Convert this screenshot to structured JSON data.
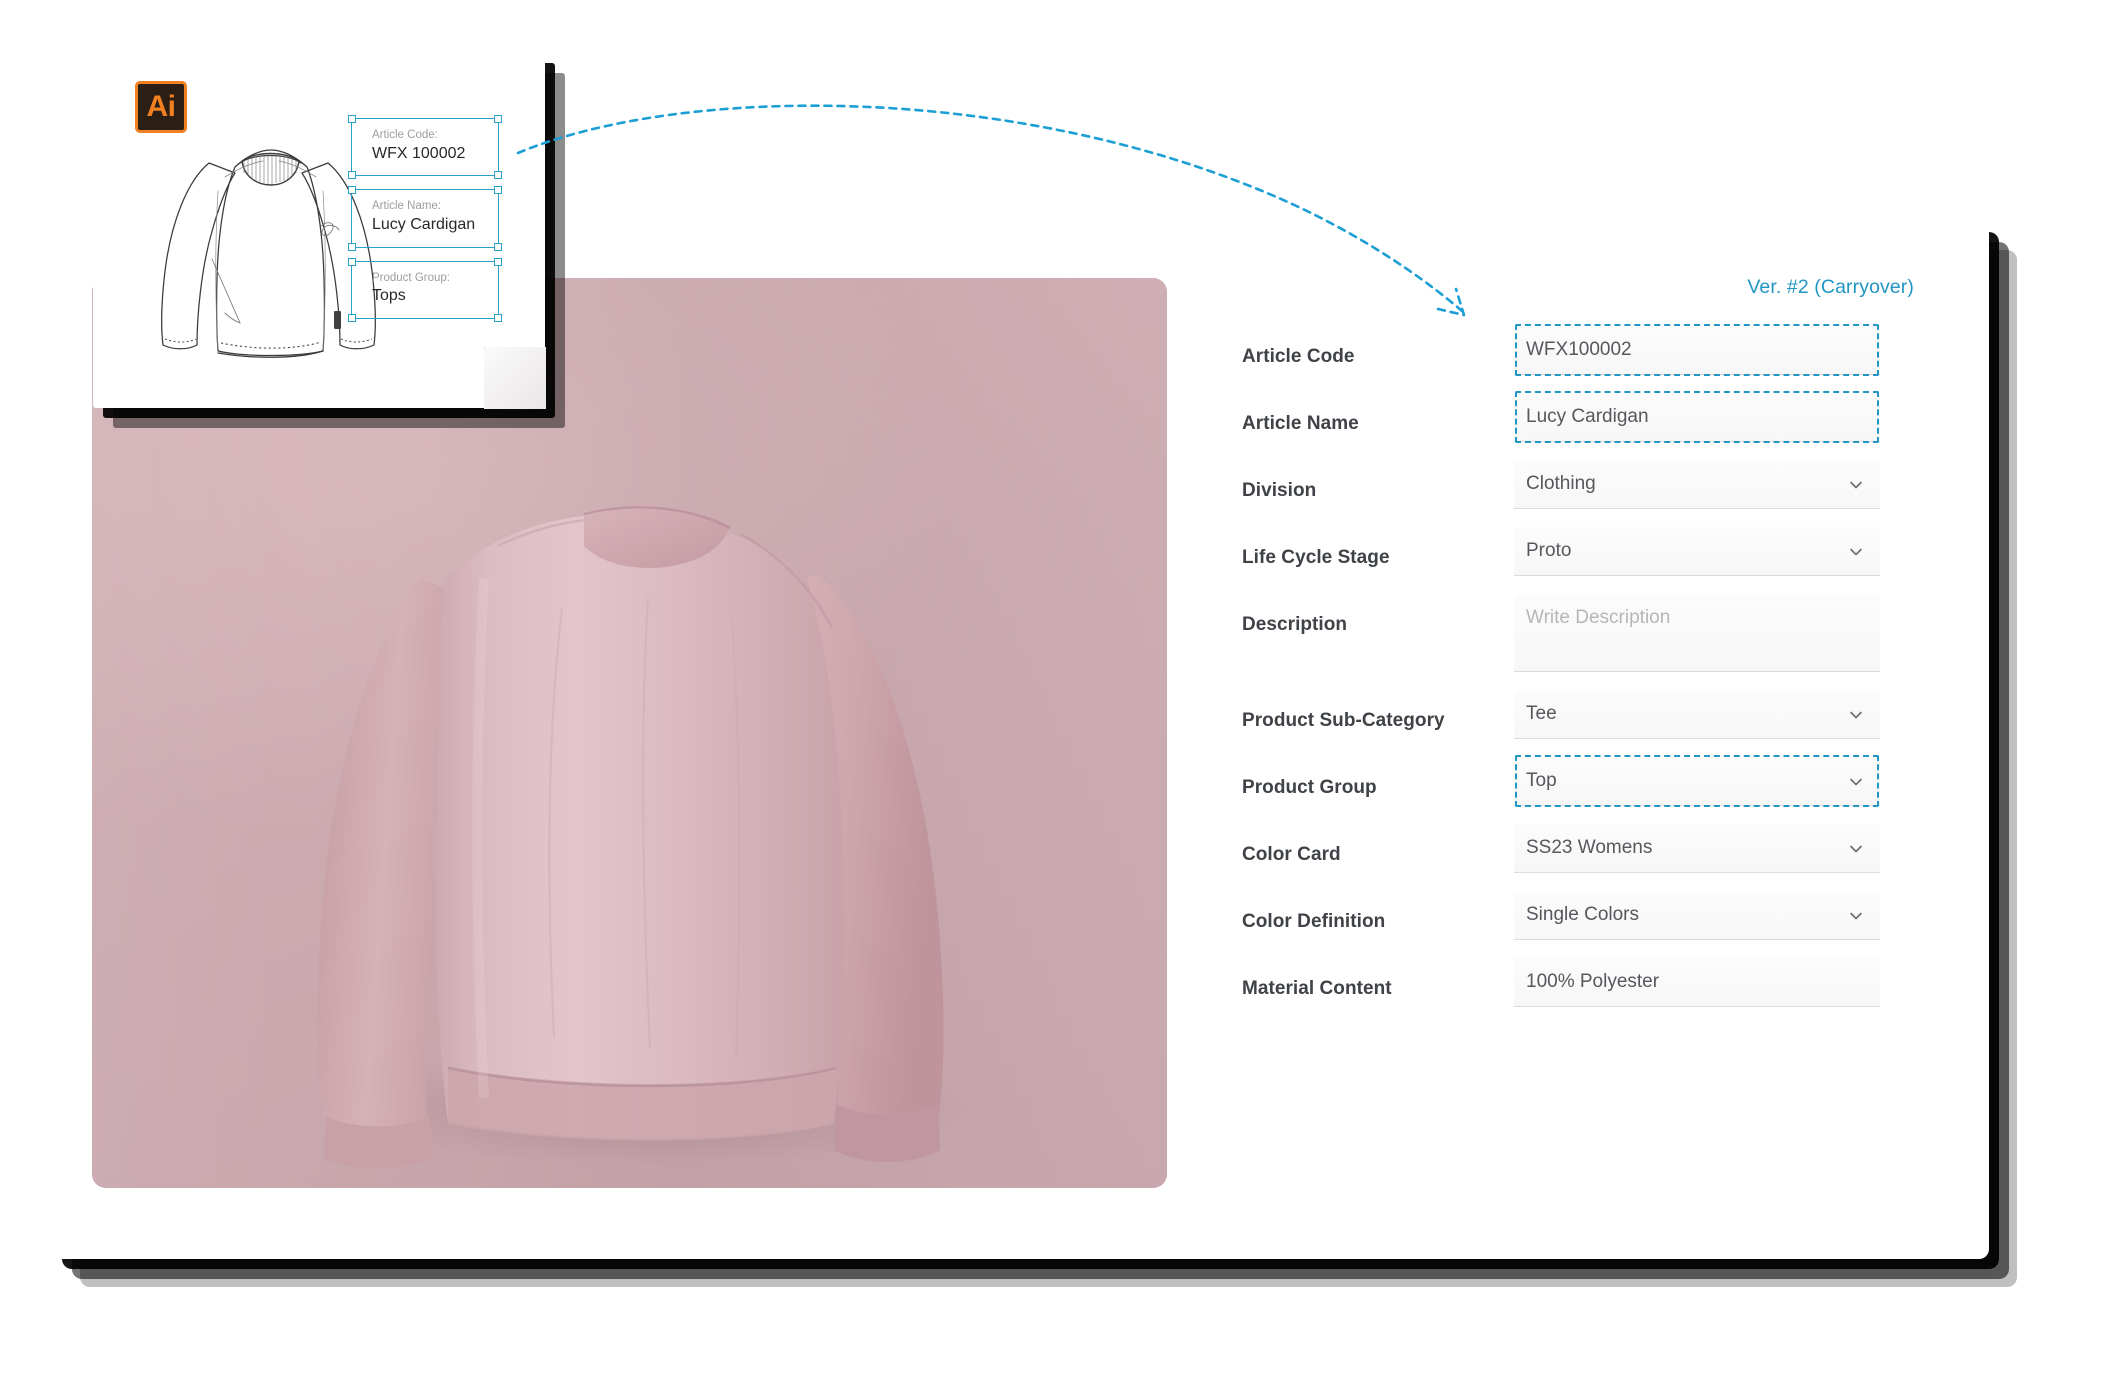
{
  "version_badge": "Ver. #2 (Carryover)",
  "ai_card": {
    "app_icon_label": "Ai",
    "fields": [
      {
        "label": "Article Code:",
        "value": "WFX 100002"
      },
      {
        "label": "Article Name:",
        "value": "Lucy Cardigan"
      },
      {
        "label": "Product Group:",
        "value": "Tops"
      }
    ]
  },
  "form": {
    "rows": [
      {
        "label": "Article Code",
        "value": "WFX100002",
        "type": "text",
        "highlight": true,
        "chevron": false,
        "placeholder": ""
      },
      {
        "label": "Article Name",
        "value": "Lucy Cardigan",
        "type": "text",
        "highlight": true,
        "chevron": false,
        "placeholder": ""
      },
      {
        "label": "Division",
        "value": "Clothing",
        "type": "select",
        "highlight": false,
        "chevron": true,
        "placeholder": ""
      },
      {
        "label": "Life Cycle Stage",
        "value": "Proto",
        "type": "select",
        "highlight": false,
        "chevron": true,
        "placeholder": ""
      },
      {
        "label": "Description",
        "value": "",
        "type": "textarea",
        "highlight": false,
        "chevron": false,
        "placeholder": "Write Description"
      },
      {
        "label": "Product Sub-Category",
        "value": "Tee",
        "type": "select",
        "highlight": false,
        "chevron": true,
        "placeholder": ""
      },
      {
        "label": "Product Group",
        "value": "Top",
        "type": "select",
        "highlight": true,
        "chevron": true,
        "placeholder": ""
      },
      {
        "label": "Color Card",
        "value": "SS23 Womens",
        "type": "select",
        "highlight": false,
        "chevron": true,
        "placeholder": ""
      },
      {
        "label": "Color Definition",
        "value": "Single Colors",
        "type": "select",
        "highlight": false,
        "chevron": true,
        "placeholder": ""
      },
      {
        "label": "Material Content",
        "value": "100% Polyester",
        "type": "text",
        "highlight": false,
        "chevron": false,
        "placeholder": ""
      }
    ]
  },
  "colors": {
    "accent_blue": "#2196c4",
    "illustrator_orange": "#f08020",
    "illustrator_dark": "#2b1e14",
    "photo_backdrop": "#cfadb2",
    "garment_pink": "#d8b5bb",
    "label_text": "#3f4246",
    "value_text": "#55585c",
    "placeholder_text": "#b4b6b9"
  },
  "icons": {
    "chevron": "chevron-down-icon",
    "app": "adobe-illustrator-icon",
    "connector": "curved-dashed-arrow-icon"
  }
}
